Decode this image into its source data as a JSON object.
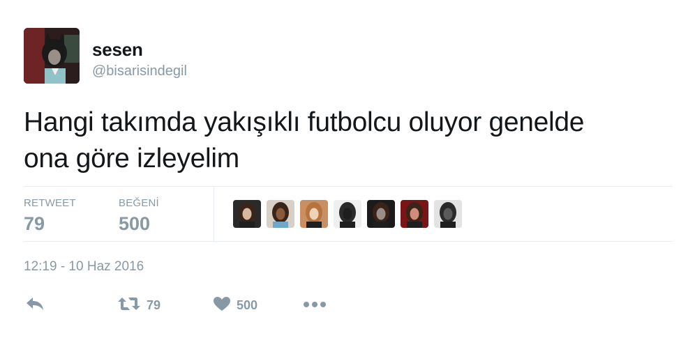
{
  "user": {
    "name": "sesen",
    "handle": "@bisarisindegil"
  },
  "tweet": {
    "text_line1": "Hangi takımda yakışıklı futbolcu oluyor genelde",
    "text_line2": "ona göre izleyelim",
    "timestamp": "12:19 - 10 Haz 2016"
  },
  "stats": {
    "retweet_label": "RETWEET",
    "retweet_count": "79",
    "like_label": "BEĞENİ",
    "like_count": "500"
  },
  "actions": {
    "retweet_count": "79",
    "like_count": "500"
  },
  "likers": [
    {
      "icon": "avatar-dark-hair",
      "bg": "#2a2a2a",
      "fg": "#d7b7a2"
    },
    {
      "icon": "avatar-long-hair",
      "bg": "#d8cfc6",
      "fg": "#8a5a3c"
    },
    {
      "icon": "avatar-blonde",
      "bg": "#c98f62",
      "fg": "#f0d2b6"
    },
    {
      "icon": "avatar-dark",
      "bg": "#efefef",
      "fg": "#1e1e1e"
    },
    {
      "icon": "avatar-hat",
      "bg": "#1b1b1b",
      "fg": "#9b8e86"
    },
    {
      "icon": "avatar-red",
      "bg": "#7a1516",
      "fg": "#d18c7b"
    },
    {
      "icon": "avatar-bw",
      "bg": "#e3e3e3",
      "fg": "#5a5a5a"
    }
  ],
  "colors": {
    "text": "#14171a",
    "muted": "#8899a6",
    "divider": "#e6ecf0"
  }
}
